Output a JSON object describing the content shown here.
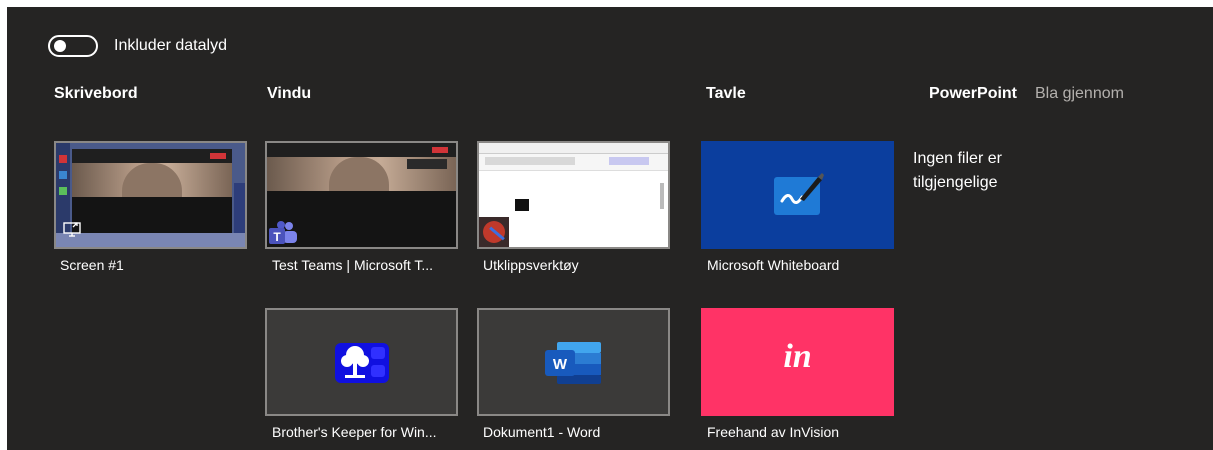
{
  "toggle": {
    "label": "Inkluder datalyd",
    "on": false
  },
  "sections": {
    "desktop": "Skrivebord",
    "window": "Vindu",
    "whiteboard": "Tavle",
    "powerpoint": "PowerPoint",
    "browse": "Bla gjennom",
    "empty_message": "Ingen filer er tilgjengelige"
  },
  "tiles": {
    "screen1": "Screen #1",
    "teams": "Test Teams | Microsoft T...",
    "snipping": "Utklippsverktøy",
    "ms_whiteboard": "Microsoft Whiteboard",
    "brothers_keeper": "Brother's Keeper for Win...",
    "word": "Dokument1 - Word",
    "freehand": "Freehand av InVision"
  },
  "icons": {
    "word_letter": "W",
    "invision_text": "in"
  },
  "colors": {
    "background": "#252423",
    "whiteboard_tile": "#0b3e9e",
    "freehand_tile": "#ff3366",
    "window_tile": "#3b3a39"
  }
}
